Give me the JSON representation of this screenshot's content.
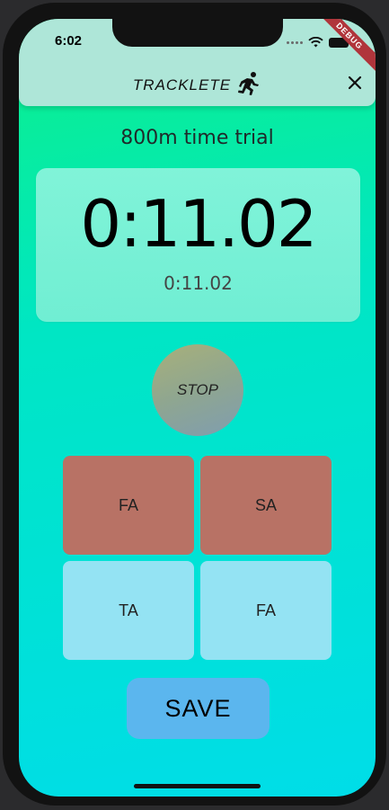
{
  "status_bar": {
    "time": "6:02",
    "debug_label": "DEBUG"
  },
  "appbar": {
    "brand": "TRACKLETE",
    "brand_icon": "running-person-icon",
    "close_icon": "close-icon"
  },
  "trial": {
    "title": "800m time trial"
  },
  "timer": {
    "main": "0:11.02",
    "sub": "0:11.02"
  },
  "controls": {
    "stop_label": "STOP",
    "buttons": [
      {
        "label": "FA",
        "color": "#b87265"
      },
      {
        "label": "SA",
        "color": "#b87265"
      },
      {
        "label": "TA",
        "color": "#94e3f3"
      },
      {
        "label": "FA",
        "color": "#94e3f3"
      }
    ],
    "save_label": "SAVE"
  },
  "colors": {
    "gradient_top": "#0cf089",
    "gradient_bottom": "#00dde8",
    "appbar": "#aee6d8",
    "save_button": "#5bb6ee"
  }
}
